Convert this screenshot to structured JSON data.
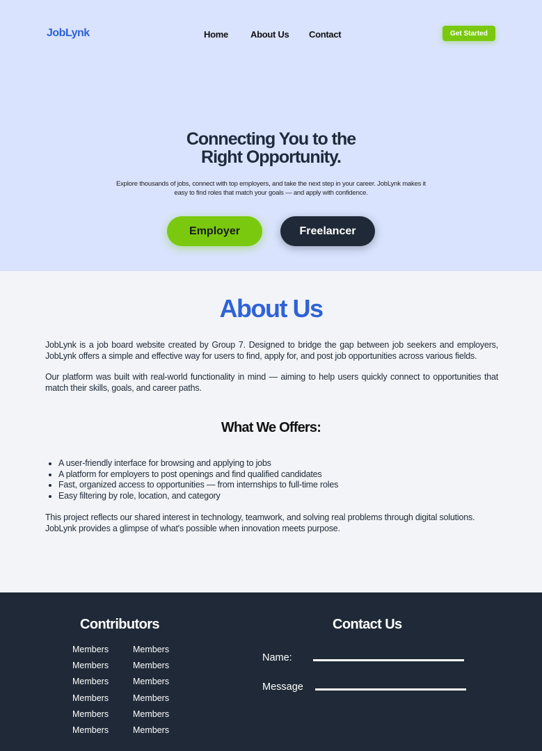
{
  "header": {
    "logo": "JobLynk",
    "nav": [
      "Home",
      "About Us",
      "Contact"
    ],
    "cta": "Get Started"
  },
  "hero": {
    "title_line1": "Connecting You to the",
    "title_line2": "Right Opportunity.",
    "subtitle_line1": "Explore thousands of jobs, connect with top employers, and take the next step in your career. JobLynk makes it",
    "subtitle_line2": "easy to find roles that match your goals — and apply with confidence.",
    "employer_button": "Employer",
    "freelancer_button": "Freelancer"
  },
  "about": {
    "title": "About Us",
    "paragraph1": "JobLynk is a job board website created by Group 7. Designed to bridge the gap between job seekers and employers, JobLynk offers a simple and effective way for users to find, apply for, and post job opportunities across various fields.",
    "paragraph2": "Our platform was built with real-world functionality in mind — aiming to help users quickly connect to opportunities that match their skills, goals, and career paths.",
    "offers_title": "What We Offers:",
    "offers": [
      "A user-friendly interface for browsing and applying to jobs",
      "A platform for employers to post openings and find qualified candidates",
      "Fast, organized access to opportunities — from internships to full-time roles",
      "Easy filtering by role, location, and category"
    ],
    "paragraph3_line1": "This project reflects our shared interest in technology, teamwork, and solving real problems through digital solutions.",
    "paragraph3_line2": "JobLynk provides a glimpse of what's possible when innovation meets purpose."
  },
  "footer": {
    "contributors_title": "Contributors",
    "members_col1": [
      "Members",
      "Members",
      "Members",
      "Members",
      "Members",
      "Members"
    ],
    "members_col2": [
      "Members",
      "Members",
      "Members",
      "Members",
      "Members",
      "Members"
    ],
    "contact_title": "Contact Us",
    "name_label": "Name:",
    "message_label": "Message"
  },
  "colors": {
    "brand_blue": "#2f62d6",
    "accent_green": "#7ac90f",
    "dark_navy": "#1f2937",
    "hero_bg": "#d9e3fd"
  }
}
